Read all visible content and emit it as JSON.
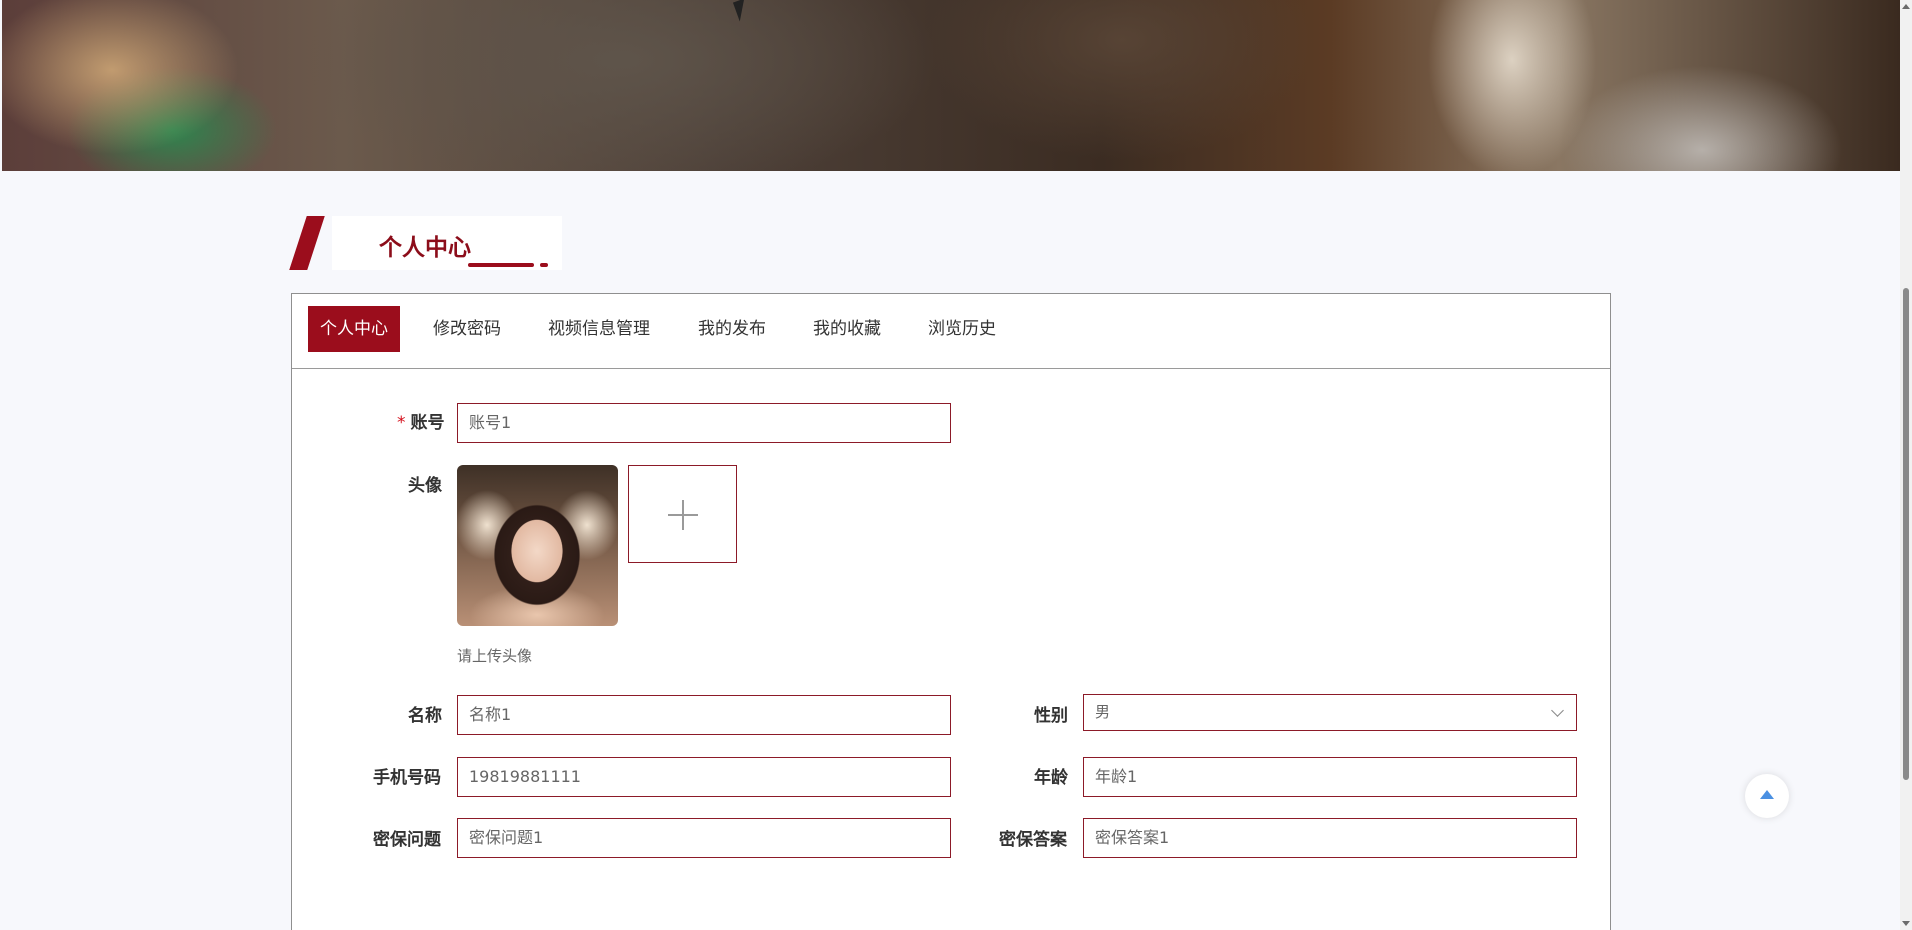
{
  "banner": {
    "alt": "banner image"
  },
  "section": {
    "title": "个人中心"
  },
  "tabs": [
    {
      "label": "个人中心",
      "active": true
    },
    {
      "label": "修改密码",
      "active": false
    },
    {
      "label": "视频信息管理",
      "active": false
    },
    {
      "label": "我的发布",
      "active": false
    },
    {
      "label": "我的收藏",
      "active": false
    },
    {
      "label": "浏览历史",
      "active": false
    }
  ],
  "form": {
    "account": {
      "required_mark": "*",
      "label": "账号",
      "value": "账号1"
    },
    "avatar": {
      "label": "头像",
      "hint": "请上传头像"
    },
    "name": {
      "label": "名称",
      "value": "名称1"
    },
    "gender": {
      "label": "性别",
      "value": "男"
    },
    "phone": {
      "label": "手机号码",
      "value": "19819881111"
    },
    "age": {
      "label": "年龄",
      "value": "年龄1"
    },
    "security_question": {
      "label": "密保问题",
      "value": "密保问题1"
    },
    "security_answer": {
      "label": "密保答案",
      "value": "密保答案1"
    }
  },
  "colors": {
    "primary": "#9b0d1c",
    "required": "#d40f1b",
    "back_to_top": "#4a90e2"
  },
  "icons": {
    "upload": "plus-icon",
    "select": "chevron-down-icon",
    "back_to_top": "arrow-up-icon"
  }
}
